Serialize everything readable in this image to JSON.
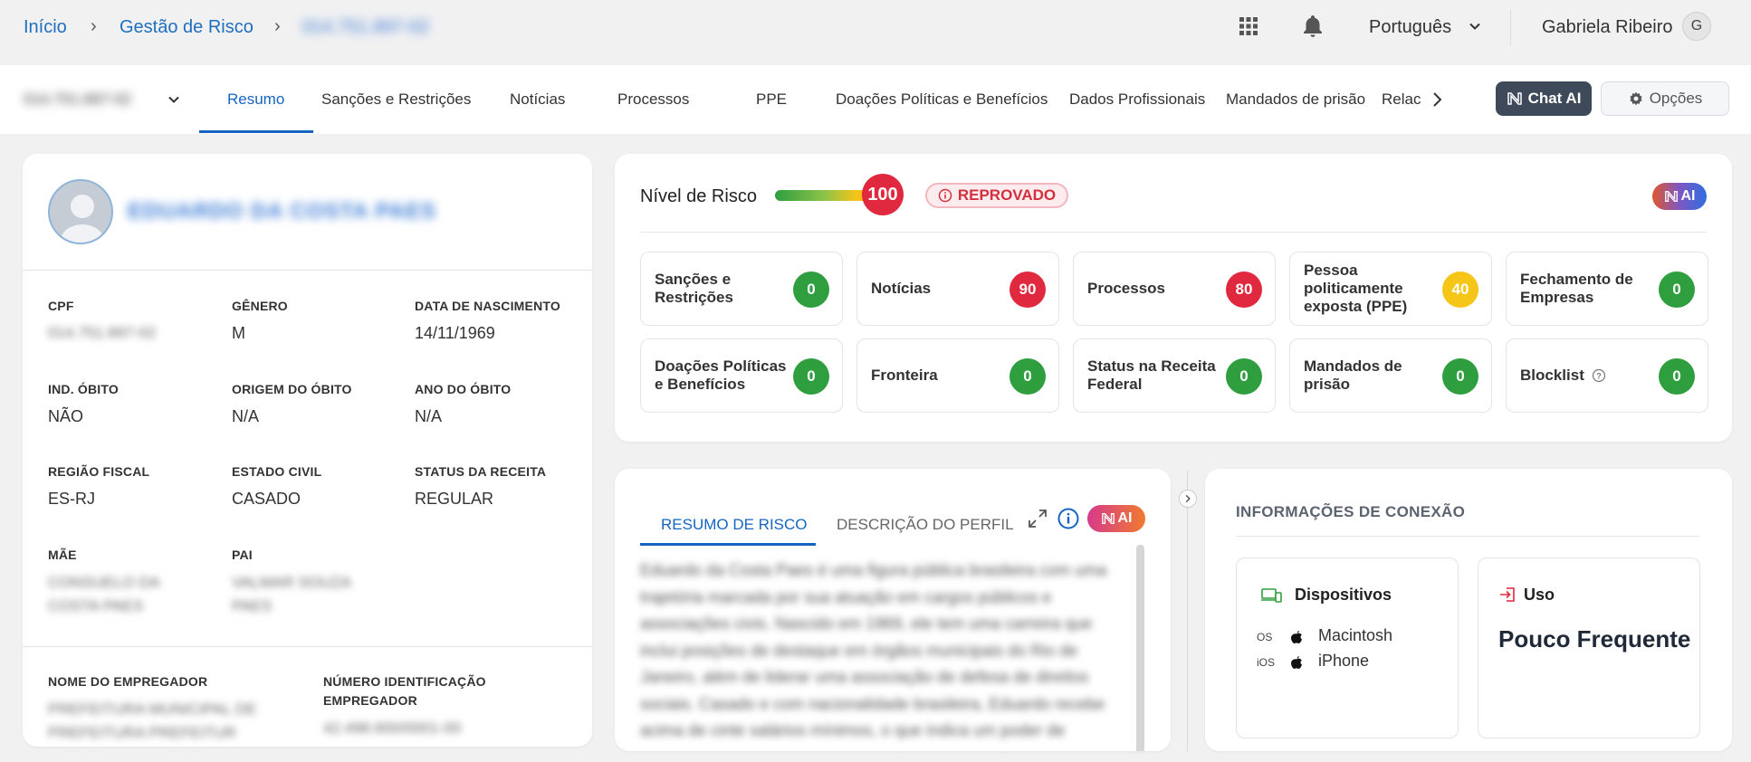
{
  "breadcrumb": {
    "home": "Início",
    "section": "Gestão de Risco",
    "current": "014.751.897-02"
  },
  "topbar": {
    "language": "Português",
    "user_name": "Gabriela Ribeiro",
    "user_initial": "G"
  },
  "entity_selector": "014.751.897-02",
  "tabs": [
    "Resumo",
    "Sanções e Restrições",
    "Notícias",
    "Processos",
    "PPE",
    "Doações Políticas e Benefícios",
    "Dados Profissionais",
    "Mandados de prisão",
    "Relac"
  ],
  "actions": {
    "chat_ai": "Chat AI",
    "options": "Opções"
  },
  "profile": {
    "name": "EDUARDO DA COSTA PAES",
    "fields": {
      "cpf": {
        "label": "CPF",
        "value": "014.751.897-02"
      },
      "genero": {
        "label": "GÊNERO",
        "value": "M"
      },
      "nascimento": {
        "label": "DATA DE NASCIMENTO",
        "value": "14/11/1969"
      },
      "ind_obito": {
        "label": "IND. ÓBITO",
        "value": "NÃO"
      },
      "origem_obito": {
        "label": "ORIGEM DO ÓBITO",
        "value": "N/A"
      },
      "ano_obito": {
        "label": "ANO DO ÓBITO",
        "value": "N/A"
      },
      "regiao": {
        "label": "REGIÃO FISCAL",
        "value": "ES-RJ"
      },
      "estado_civil": {
        "label": "ESTADO CIVIL",
        "value": "CASADO"
      },
      "status_receita": {
        "label": "STATUS DA RECEITA",
        "value": "REGULAR"
      },
      "mae": {
        "label": "MÃE",
        "value_l1": "CONSUELO DA",
        "value_l2": "COSTA PAES"
      },
      "pai": {
        "label": "PAI",
        "value_l1": "VALMAR SOUZA",
        "value_l2": "PAES"
      },
      "empregador": {
        "label": "NOME DO EMPREGADOR",
        "value_l1": "PREFEITURA MUNICIPAL DE",
        "value_l2": "PREFEITURA PREFEITUR"
      },
      "num_empregador": {
        "label_l1": "NÚMERO IDENTIFICAÇÃO",
        "label_l2": "EMPREGADOR",
        "value": "42.498.600/0001-00"
      }
    }
  },
  "risk": {
    "title": "Nível de Risco",
    "score": "100",
    "status": "REPROVADO",
    "ai_label": "AI",
    "categories": [
      {
        "label": "Sanções e Restrições",
        "value": "0",
        "color": "#2e9e3e"
      },
      {
        "label": "Notícias",
        "value": "90",
        "color": "#e0283e"
      },
      {
        "label": "Processos",
        "value": "80",
        "color": "#e0283e"
      },
      {
        "label": "Pessoa politicamente exposta (PPE)",
        "value": "40",
        "color": "#f5c518"
      },
      {
        "label": "Fechamento de Empresas",
        "value": "0",
        "color": "#2e9e3e"
      },
      {
        "label": "Doações Políticas e Benefícios",
        "value": "0",
        "color": "#2e9e3e"
      },
      {
        "label": "Fronteira",
        "value": "0",
        "color": "#2e9e3e"
      },
      {
        "label": "Status na Receita Federal",
        "value": "0",
        "color": "#2e9e3e"
      },
      {
        "label": "Mandados de prisão",
        "value": "0",
        "color": "#2e9e3e"
      },
      {
        "label": "Blocklist",
        "value": "0",
        "color": "#2e9e3e"
      }
    ]
  },
  "summary": {
    "tab_active": "RESUMO DE RISCO",
    "tab_other": "DESCRIÇÃO DO PERFIL",
    "ai_label": "AI",
    "text": "Eduardo da Costa Paes é uma figura pública brasileira com uma trajetória marcada por sua atuação em cargos públicos e associações civis. Nascido em 1969, ele tem uma carreira que inclui posições de destaque em órgãos municipais do Rio de Janeiro, além de liderar uma associação de defesa de direitos sociais. Casado e com nacionalidade brasileira, Eduardo recebe acima de cinte salários mínimos, o que indica um poder de"
  },
  "connection": {
    "title": "INFORMAÇÕES DE CONEXÃO",
    "devices_title": "Dispositivos",
    "devices": [
      {
        "os": "OS",
        "name": "Macintosh"
      },
      {
        "os": "iOS",
        "name": "iPhone"
      }
    ],
    "usage_title": "Uso",
    "usage_value": "Pouco Frequente"
  }
}
